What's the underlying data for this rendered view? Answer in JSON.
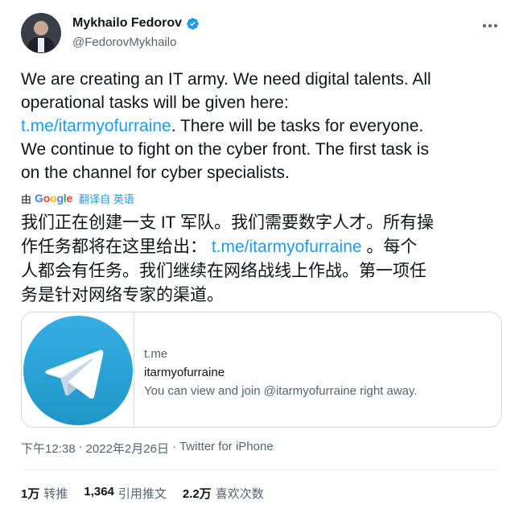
{
  "author": {
    "display_name": "Mykhailo Fedorov",
    "handle": "@FedorovMykhailo",
    "verified": true
  },
  "tweet": {
    "lines": [
      [
        {
          "text": "We are creating an IT army. We need digital talents. All"
        }
      ],
      [
        {
          "text": "operational tasks will be given here:"
        }
      ],
      [
        {
          "text": "t.me/itarmyofurraine",
          "link": true
        },
        {
          "text": ". There will be tasks for everyone."
        }
      ],
      [
        {
          "text": "We continue to fight on the cyber front. The first task is"
        }
      ],
      [
        {
          "text": "on the channel for cyber specialists."
        }
      ]
    ]
  },
  "translation": {
    "by_label": "由",
    "provider": "Google",
    "action_label": "翻译自 英语",
    "lines": [
      [
        {
          "text": "我们正在创建一支 IT 军队。我们需要数字人才。所有操"
        }
      ],
      [
        {
          "text": "作任务都将在这里给出： "
        },
        {
          "text": "t.me/itarmyofurraine",
          "link": true
        },
        {
          "text": " 。每个"
        }
      ],
      [
        {
          "text": "人都会有任务。我们继续在网络战线上作战。第一项任"
        }
      ],
      [
        {
          "text": "务是针对网络专家的渠道。"
        }
      ]
    ]
  },
  "card": {
    "icon": "telegram-logo",
    "domain": "t.me",
    "title": "itarmyofurraine",
    "description": "You can view and join @itarmyofurraine right away."
  },
  "meta": {
    "time": "下午12:38",
    "separator": "·",
    "date": "2022年2月26日",
    "source": "Twitter for iPhone"
  },
  "stats": [
    {
      "value": "1万",
      "label": "转推"
    },
    {
      "value": "1,364",
      "label": "引用推文"
    },
    {
      "value": "2.2万",
      "label": "喜欢次数"
    }
  ],
  "colors": {
    "link": "#1d9bf0",
    "secondary_text": "#536471",
    "telegram_blue": "#2aa3e0"
  }
}
